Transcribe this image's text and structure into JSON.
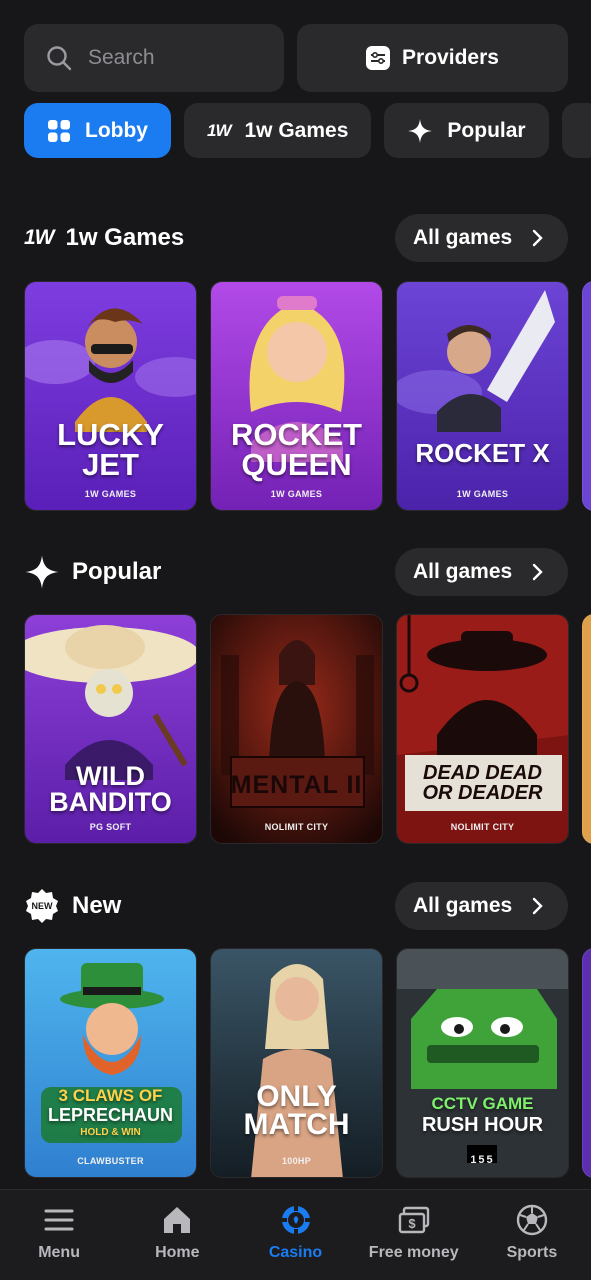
{
  "search": {
    "placeholder": "Search"
  },
  "providers_label": "Providers",
  "tabs": [
    {
      "label": "Lobby",
      "icon": "grid-icon",
      "active": true
    },
    {
      "label": "1w Games",
      "icon": "1w-logo-icon",
      "active": false
    },
    {
      "label": "Popular",
      "icon": "sparkle-icon",
      "active": false
    }
  ],
  "sections": [
    {
      "title": "1w Games",
      "icon": "1w-logo-icon",
      "all_label": "All games",
      "games": [
        {
          "title_line1": "LUCKY",
          "title_line2": "JET",
          "provider": "1W GAMES"
        },
        {
          "title_line1": "ROCKET",
          "title_line2": "QUEEN",
          "provider": "1W GAMES"
        },
        {
          "title_line1": "ROCKET X",
          "title_line2": "",
          "provider": "1W GAMES"
        }
      ]
    },
    {
      "title": "Popular",
      "icon": "sparkle-icon",
      "all_label": "All games",
      "games": [
        {
          "title_line1": "WILD",
          "title_line2": "BANDITO",
          "provider": "PG SOFT"
        },
        {
          "title_line1": "MENTAL II",
          "title_line2": "",
          "provider": "NOLIMIT CITY"
        },
        {
          "title_line1": "DEAD DEAD",
          "title_line2": "OR DEADER",
          "provider": "NOLIMIT CITY"
        }
      ]
    },
    {
      "title": "New",
      "icon": "new-badge-icon",
      "badge_text": "NEW",
      "all_label": "All games",
      "games": [
        {
          "title_line1": "3 CLAWS OF",
          "title_line2": "LEPRECHAUN",
          "subtitle": "HOLD & WIN",
          "provider": "CLAWBUSTER"
        },
        {
          "title_line1": "ONLY",
          "title_line2": "MATCH",
          "provider": "100HP"
        },
        {
          "title_line1": "CCTV GAME",
          "title_line2": "RUSH HOUR",
          "provider": "155"
        }
      ]
    }
  ],
  "bottom_nav": [
    {
      "label": "Menu",
      "icon": "menu-icon",
      "active": false
    },
    {
      "label": "Home",
      "icon": "home-icon",
      "active": false
    },
    {
      "label": "Casino",
      "icon": "casino-chip-icon",
      "active": true
    },
    {
      "label": "Free money",
      "icon": "money-icon",
      "active": false
    },
    {
      "label": "Sports",
      "icon": "soccer-ball-icon",
      "active": false
    }
  ],
  "colors": {
    "accent": "#1b7cf2",
    "background": "#171719",
    "surface": "#2a2a2d"
  }
}
